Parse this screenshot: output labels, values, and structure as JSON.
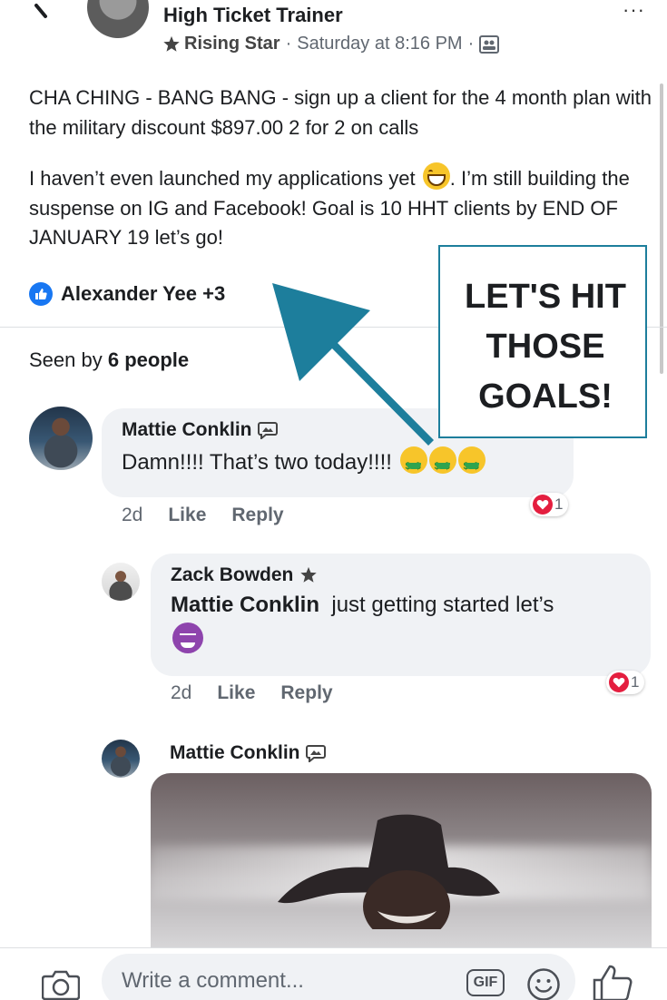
{
  "post": {
    "author": "High Ticket Trainer",
    "badge": "Rising Star",
    "timestamp": "Saturday at 8:16 PM",
    "separator": "·",
    "body_p1": "CHA CHING - BANG BANG - sign up a client for the 4 month plan with the military discount $897.00 2 for 2 on calls",
    "body_p2_a": "I haven’t even launched my applications yet",
    "body_p2_b": ". I’m still building the suspense on IG and Facebook! Goal is 10 HHT clients by END OF JANUARY 19 let’s go!",
    "reactions": "Alexander Yee +3",
    "seen_prefix": "Seen by",
    "seen_count": "6 people"
  },
  "overlay": {
    "text": "LET'S HIT THOSE GOALS!",
    "color": "#1d7e9c"
  },
  "comments": [
    {
      "name": "Mattie Conklin",
      "text": "Damn!!!! That’s two today!!!!",
      "time": "2d",
      "like_label": "Like",
      "reply_label": "Reply",
      "reaction_count": "1"
    },
    {
      "name": "Zack Bowden",
      "mention": "Mattie Conklin",
      "text": "just getting started let’s",
      "time": "2d",
      "like_label": "Like",
      "reply_label": "Reply",
      "reaction_count": "1"
    },
    {
      "name": "Mattie Conklin"
    }
  ],
  "composer": {
    "placeholder": "Write a comment...",
    "gif_label": "GIF"
  },
  "colors": {
    "facebook_blue": "#1877f2",
    "heart_red": "#e41e3f",
    "bubble_bg": "#f0f2f5",
    "teal_accent": "#1d7e9c"
  },
  "icons": [
    "back-chevron-icon",
    "more-icon",
    "star-badge-icon",
    "group-icon",
    "like-reaction-icon",
    "heart-reaction-icon",
    "money-mouth-emoji",
    "grinning-emoji",
    "devil-emoji",
    "camera-icon",
    "gif-icon",
    "emoji-icon",
    "like-icon",
    "photo-comment-icon"
  ]
}
